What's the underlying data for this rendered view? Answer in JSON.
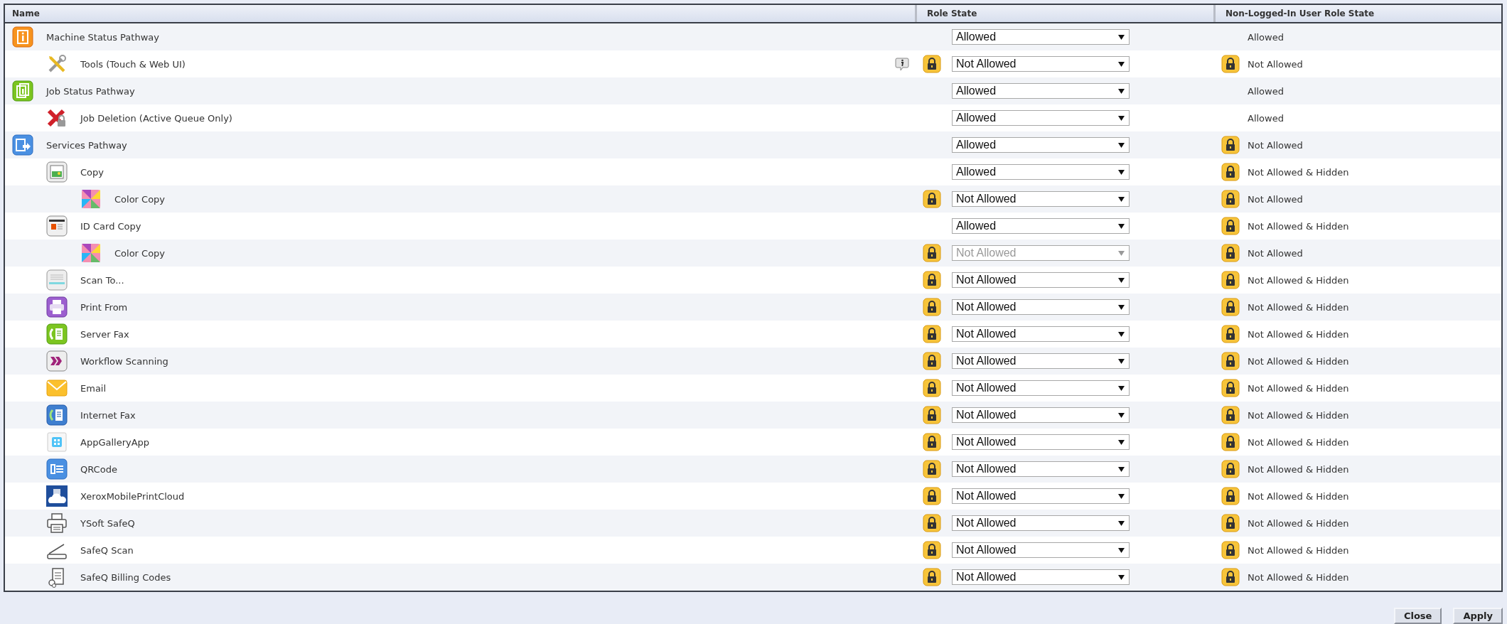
{
  "table": {
    "columns": [
      "Name",
      "Role State",
      "Non-Logged-In User Role State"
    ],
    "rows": [
      {
        "name": "Machine Status Pathway",
        "kind": "status",
        "info": false,
        "role": {
          "value": "Allowed",
          "locked": false,
          "disabled": false
        },
        "guest": {
          "value": "Allowed",
          "locked": false
        },
        "children": [
          {
            "name": "Tools (Touch & Web UI)",
            "kind": "tools",
            "info": true,
            "role": {
              "value": "Not Allowed",
              "locked": true,
              "disabled": false
            },
            "guest": {
              "value": "Not Allowed",
              "locked": true
            }
          }
        ]
      },
      {
        "name": "Job Status Pathway",
        "kind": "jobs",
        "info": false,
        "role": {
          "value": "Allowed",
          "locked": false,
          "disabled": false
        },
        "guest": {
          "value": "Allowed",
          "locked": false
        },
        "children": [
          {
            "name": "Job Deletion (Active Queue Only)",
            "kind": "deletion",
            "info": false,
            "role": {
              "value": "Allowed",
              "locked": false,
              "disabled": false
            },
            "guest": {
              "value": "Allowed",
              "locked": false
            }
          }
        ]
      },
      {
        "name": "Services Pathway",
        "kind": "services",
        "info": false,
        "role": {
          "value": "Allowed",
          "locked": false,
          "disabled": false
        },
        "guest": {
          "value": "Not Allowed",
          "locked": true
        },
        "children": [
          {
            "name": "Copy",
            "kind": "copy",
            "info": false,
            "role": {
              "value": "Allowed",
              "locked": false,
              "disabled": false
            },
            "guest": {
              "value": "Not Allowed & Hidden",
              "locked": true
            },
            "children": [
              {
                "name": "Color Copy",
                "kind": "colorcopy",
                "info": false,
                "role": {
                  "value": "Not Allowed",
                  "locked": true,
                  "disabled": false
                },
                "guest": {
                  "value": "Not Allowed",
                  "locked": true
                }
              }
            ]
          },
          {
            "name": "ID Card Copy",
            "kind": "idcard",
            "info": false,
            "role": {
              "value": "Allowed",
              "locked": false,
              "disabled": false
            },
            "guest": {
              "value": "Not Allowed & Hidden",
              "locked": true
            },
            "children": [
              {
                "name": "Color Copy",
                "kind": "colorcopy",
                "info": false,
                "role": {
                  "value": "Not Allowed",
                  "locked": true,
                  "disabled": true
                },
                "guest": {
                  "value": "Not Allowed",
                  "locked": true
                }
              }
            ]
          },
          {
            "name": "Scan To...",
            "kind": "scan",
            "info": false,
            "role": {
              "value": "Not Allowed",
              "locked": true,
              "disabled": false
            },
            "guest": {
              "value": "Not Allowed & Hidden",
              "locked": true
            }
          },
          {
            "name": "Print From",
            "kind": "print",
            "info": false,
            "role": {
              "value": "Not Allowed",
              "locked": true,
              "disabled": false
            },
            "guest": {
              "value": "Not Allowed & Hidden",
              "locked": true
            }
          },
          {
            "name": "Server Fax",
            "kind": "fax",
            "info": false,
            "role": {
              "value": "Not Allowed",
              "locked": true,
              "disabled": false
            },
            "guest": {
              "value": "Not Allowed & Hidden",
              "locked": true
            }
          },
          {
            "name": "Workflow Scanning",
            "kind": "workflow",
            "info": false,
            "role": {
              "value": "Not Allowed",
              "locked": true,
              "disabled": false
            },
            "guest": {
              "value": "Not Allowed & Hidden",
              "locked": true
            }
          },
          {
            "name": "Email",
            "kind": "email",
            "info": false,
            "role": {
              "value": "Not Allowed",
              "locked": true,
              "disabled": false
            },
            "guest": {
              "value": "Not Allowed & Hidden",
              "locked": true
            }
          },
          {
            "name": "Internet Fax",
            "kind": "internetfax",
            "info": false,
            "role": {
              "value": "Not Allowed",
              "locked": true,
              "disabled": false
            },
            "guest": {
              "value": "Not Allowed & Hidden",
              "locked": true
            }
          },
          {
            "name": "AppGalleryApp",
            "kind": "appgallery",
            "info": false,
            "role": {
              "value": "Not Allowed",
              "locked": true,
              "disabled": false
            },
            "guest": {
              "value": "Not Allowed & Hidden",
              "locked": true
            }
          },
          {
            "name": "QRCode",
            "kind": "qrcode",
            "info": false,
            "role": {
              "value": "Not Allowed",
              "locked": true,
              "disabled": false
            },
            "guest": {
              "value": "Not Allowed & Hidden",
              "locked": true
            }
          },
          {
            "name": "XeroxMobilePrintCloud",
            "kind": "cloud",
            "info": false,
            "role": {
              "value": "Not Allowed",
              "locked": true,
              "disabled": false
            },
            "guest": {
              "value": "Not Allowed & Hidden",
              "locked": true
            }
          },
          {
            "name": "YSoft SafeQ",
            "kind": "printer",
            "info": false,
            "role": {
              "value": "Not Allowed",
              "locked": true,
              "disabled": false
            },
            "guest": {
              "value": "Not Allowed & Hidden",
              "locked": true
            }
          },
          {
            "name": "SafeQ Scan",
            "kind": "scanner",
            "info": false,
            "role": {
              "value": "Not Allowed",
              "locked": true,
              "disabled": false
            },
            "guest": {
              "value": "Not Allowed & Hidden",
              "locked": true
            }
          },
          {
            "name": "SafeQ Billing Codes",
            "kind": "billing",
            "info": false,
            "role": {
              "value": "Not Allowed",
              "locked": true,
              "disabled": false
            },
            "guest": {
              "value": "Not Allowed & Hidden",
              "locked": true
            }
          }
        ]
      }
    ]
  },
  "buttons": [
    "Close",
    "Apply"
  ]
}
